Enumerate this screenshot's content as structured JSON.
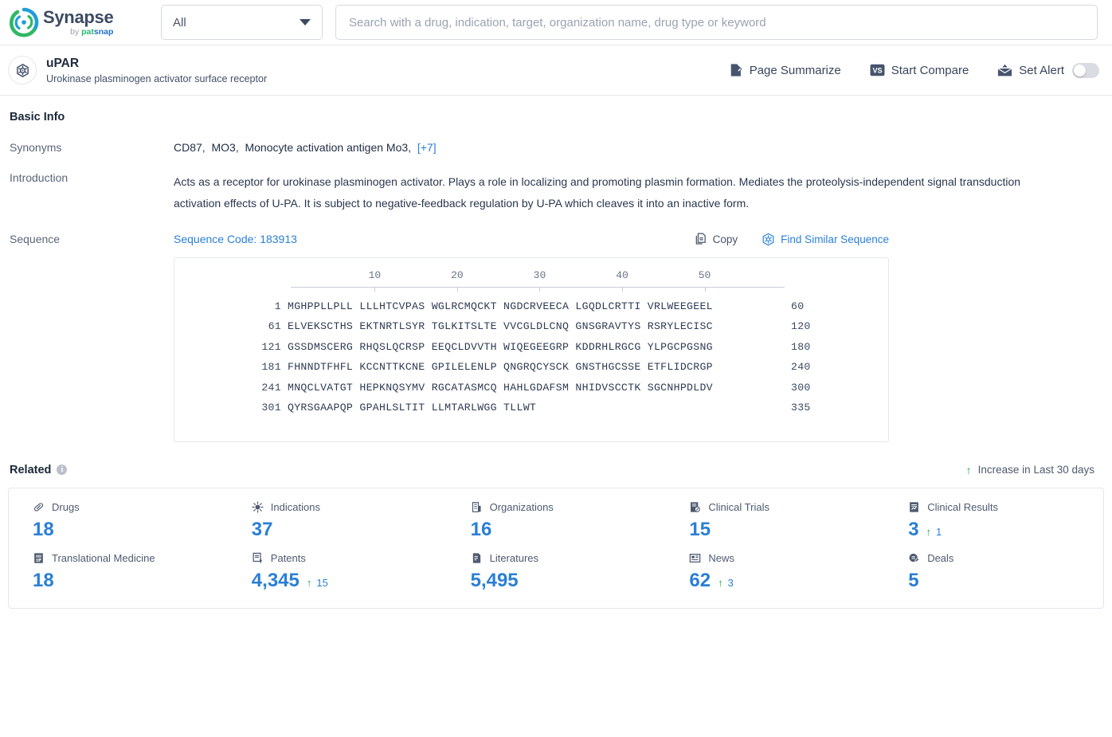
{
  "topbar": {
    "logo_title": "Synapse",
    "logo_by": "by",
    "logo_pat": "pat",
    "logo_snap": "snap",
    "filter_value": "All",
    "search_placeholder": "Search with a drug, indication, target, organization name, drug type or keyword",
    "search_value": ""
  },
  "entity": {
    "title": "uPAR",
    "subtitle": "Urokinase plasminogen activator surface receptor",
    "actions": [
      {
        "label": "Page Summarize",
        "icon": "page-summarize-icon"
      },
      {
        "label": "Start Compare",
        "icon": "versus-icon"
      },
      {
        "label": "Set Alert",
        "icon": "alert-mail-icon"
      }
    ],
    "alert_toggle_state": "off"
  },
  "basic_info": {
    "heading": "Basic Info",
    "synonyms_label": "Synonyms",
    "synonyms": [
      "CD87",
      "MO3",
      "Monocyte activation antigen Mo3"
    ],
    "synonyms_more": "[+7]",
    "introduction_label": "Introduction",
    "introduction": "Acts as a receptor for urokinase plasminogen activator. Plays a role in localizing and promoting plasmin formation. Mediates the proteolysis-independent signal transduction activation effects of U-PA. It is subject to negative-feedback regulation by U-PA which cleaves it into an inactive form.",
    "sequence_label": "Sequence",
    "sequence_code": "Sequence Code: 183913",
    "copy_label": "Copy",
    "find_similar_label": "Find Similar Sequence"
  },
  "sequence": {
    "ruler_ticks": [
      10,
      20,
      30,
      40,
      50
    ],
    "lines": [
      {
        "start": "1",
        "chunks": "MGHPPLLPLL LLLHTCVPAS WGLRCMQCKT NGDCRVEECA LGQDLCRTTI VRLWEEGEEL",
        "end": "60"
      },
      {
        "start": "61",
        "chunks": "ELVEKSCTHS EKTNRTLSYR TGLKITSLTE VVCGLDLCNQ GNSGRAVTYS RSRYLECISC",
        "end": "120"
      },
      {
        "start": "121",
        "chunks": "GSSDMSCERG RHQSLQCRSP EEQCLDVVTH WIQEGEEGRP KDDRHLRGCG YLPGCPGSNG",
        "end": "180"
      },
      {
        "start": "181",
        "chunks": "FHNNDTFHFL KCCNTTKCNE GPILELENLP QNGRQCYSCK GNSTHGCSSE ETFLIDCRGP",
        "end": "240"
      },
      {
        "start": "241",
        "chunks": "MNQCLVATGT HEPKNQSYMV RGCATASMCQ HAHLGDAFSM NHIDVSCCTK SGCNHPDLDV",
        "end": "300"
      },
      {
        "start": "301",
        "chunks": "QYRSGAAPQP GPAHLSLTIT LLMTARLWGG TLLWT",
        "end": "335"
      }
    ]
  },
  "related": {
    "heading": "Related",
    "info_glyph": "i",
    "increase_note": "Increase in Last 30 days",
    "up_arrow": "↑",
    "items": [
      {
        "label": "Drugs",
        "icon": "capsule-icon",
        "value": "18",
        "delta": ""
      },
      {
        "label": "Indications",
        "icon": "virus-icon",
        "value": "37",
        "delta": ""
      },
      {
        "label": "Organizations",
        "icon": "building-icon",
        "value": "16",
        "delta": ""
      },
      {
        "label": "Clinical Trials",
        "icon": "clinical-trial-icon",
        "value": "15",
        "delta": ""
      },
      {
        "label": "Clinical Results",
        "icon": "clinical-result-icon",
        "value": "3",
        "delta": "1"
      },
      {
        "label": "Translational Medicine",
        "icon": "translational-icon",
        "value": "18",
        "delta": ""
      },
      {
        "label": "Patents",
        "icon": "patent-icon",
        "value": "4,345",
        "delta": "15"
      },
      {
        "label": "Literatures",
        "icon": "literature-icon",
        "value": "5,495",
        "delta": ""
      },
      {
        "label": "News",
        "icon": "news-icon",
        "value": "62",
        "delta": "3"
      },
      {
        "label": "Deals",
        "icon": "deals-icon",
        "value": "5",
        "delta": ""
      }
    ]
  },
  "colors": {
    "accent_blue": "#2b7fd4",
    "increase_green": "#23a455",
    "text_dark": "#2f3b52",
    "muted": "#5b6578",
    "border": "#e4e7ec"
  }
}
